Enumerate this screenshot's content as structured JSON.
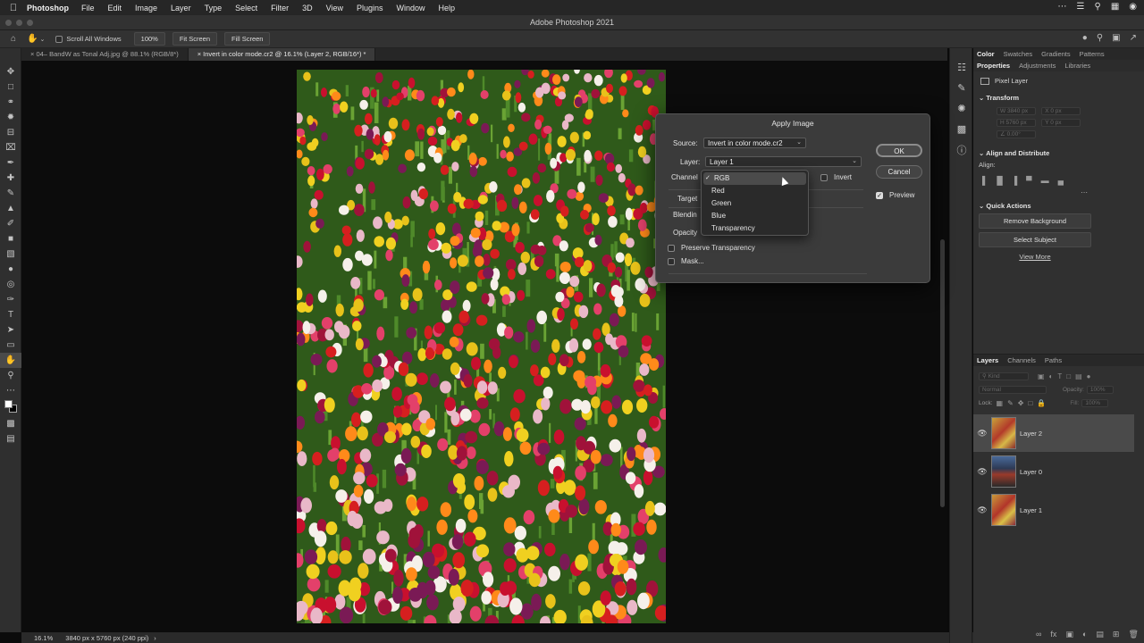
{
  "menubar": {
    "app_name": "Photoshop",
    "items": [
      "File",
      "Edit",
      "Image",
      "Layer",
      "Type",
      "Select",
      "Filter",
      "3D",
      "View",
      "Plugins",
      "Window",
      "Help"
    ]
  },
  "window": {
    "title": "Adobe Photoshop 2021"
  },
  "options_bar": {
    "scroll_all_windows": "Scroll All Windows",
    "zoom_button": "100%",
    "fit_screen": "Fit Screen",
    "fill_screen": "Fill Screen"
  },
  "tabs": [
    {
      "label": "04– BandW as Tonal Adj.jpg @ 88.1% (RGB/8*)",
      "active": false
    },
    {
      "label": "Invert in color mode.cr2 @ 16.1% (Layer 2, RGB/16*) *",
      "active": true
    }
  ],
  "status_bar": {
    "zoom": "16.1%",
    "doc_info": "3840 px x 5760 px (240 ppi)"
  },
  "right_panel": {
    "top_tabs": [
      "Color",
      "Swatches",
      "Gradients",
      "Patterns"
    ],
    "sub_tabs": [
      "Properties",
      "Adjustments",
      "Libraries"
    ],
    "pixel_layer": "Pixel Layer",
    "transform": "Transform",
    "transform_fields": {
      "w": "3840 px",
      "x": "0 px",
      "h": "5760 px",
      "y": "0 px",
      "angle": "0.00°"
    },
    "align_distribute": "Align and Distribute",
    "align_label": "Align:",
    "quick_actions": "Quick Actions",
    "remove_background": "Remove Background",
    "select_subject": "Select Subject",
    "view_more": "View More"
  },
  "layers_panel": {
    "tabs": [
      "Layers",
      "Channels",
      "Paths"
    ],
    "kind_placeholder": "Kind",
    "blend_mode": "Normal",
    "opacity_label": "Opacity:",
    "opacity_value": "100%",
    "lock_label": "Lock:",
    "fill_label": "Fill:",
    "fill_value": "100%",
    "layers": [
      {
        "name": "Layer 2",
        "selected": true
      },
      {
        "name": "Layer 0",
        "selected": false
      },
      {
        "name": "Layer 1",
        "selected": false
      }
    ]
  },
  "apply_image": {
    "title": "Apply Image",
    "source_label": "Source:",
    "source_value": "Invert in color mode.cr2",
    "layer_label": "Layer:",
    "layer_value": "Layer 1",
    "channel_label": "Channel",
    "invert_label": "Invert",
    "target_label": "Target",
    "blending_label": "Blendin",
    "opacity_label": "Opacity",
    "preserve_transparency": "Preserve Transparency",
    "mask": "Mask...",
    "ok": "OK",
    "cancel": "Cancel",
    "preview": "Preview",
    "preview_checked": true,
    "channel_options": [
      {
        "label": "RGB",
        "selected": true
      },
      {
        "label": "Red",
        "selected": false
      },
      {
        "label": "Green",
        "selected": false
      },
      {
        "label": "Blue",
        "selected": false
      },
      {
        "label": "Transparency",
        "selected": false
      }
    ]
  },
  "colors": {
    "ui_dark": "#303030",
    "canvas_bg": "#0c0c0c",
    "dialog_bg": "#3b3b3b"
  }
}
